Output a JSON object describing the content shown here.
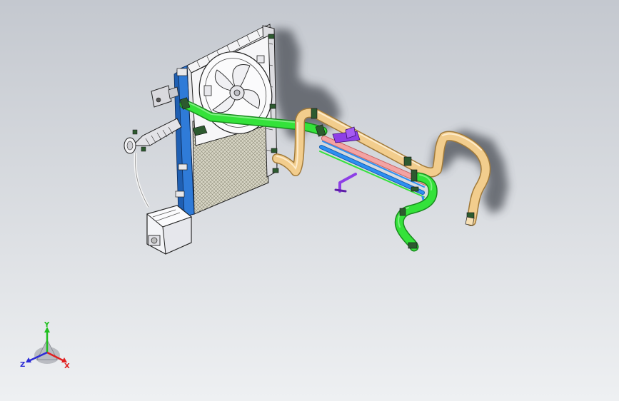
{
  "viewport": {
    "background_top": "#c4c8cf",
    "background_bottom": "#eef0f2"
  },
  "model": {
    "part_colors": {
      "radiator_core": "#d8d6c6",
      "radiator_frame": "#e7e7ea",
      "blue_bracket": "#2f7bd8",
      "green_hose": "#34e23a",
      "tan_hose": "#f2cd8d",
      "pink_tube": "#f3a3a3",
      "blue_tube": "#2d8ff2",
      "purple_bracket": "#8e3fe6",
      "reservoir": "#f3f4f7",
      "outline": "#222222"
    }
  },
  "triad": {
    "y_label": "Y",
    "z_label": "Z",
    "x_label": "X",
    "y_color": "#1fbf1f",
    "z_color": "#2b2bd6",
    "x_color": "#e02020"
  }
}
